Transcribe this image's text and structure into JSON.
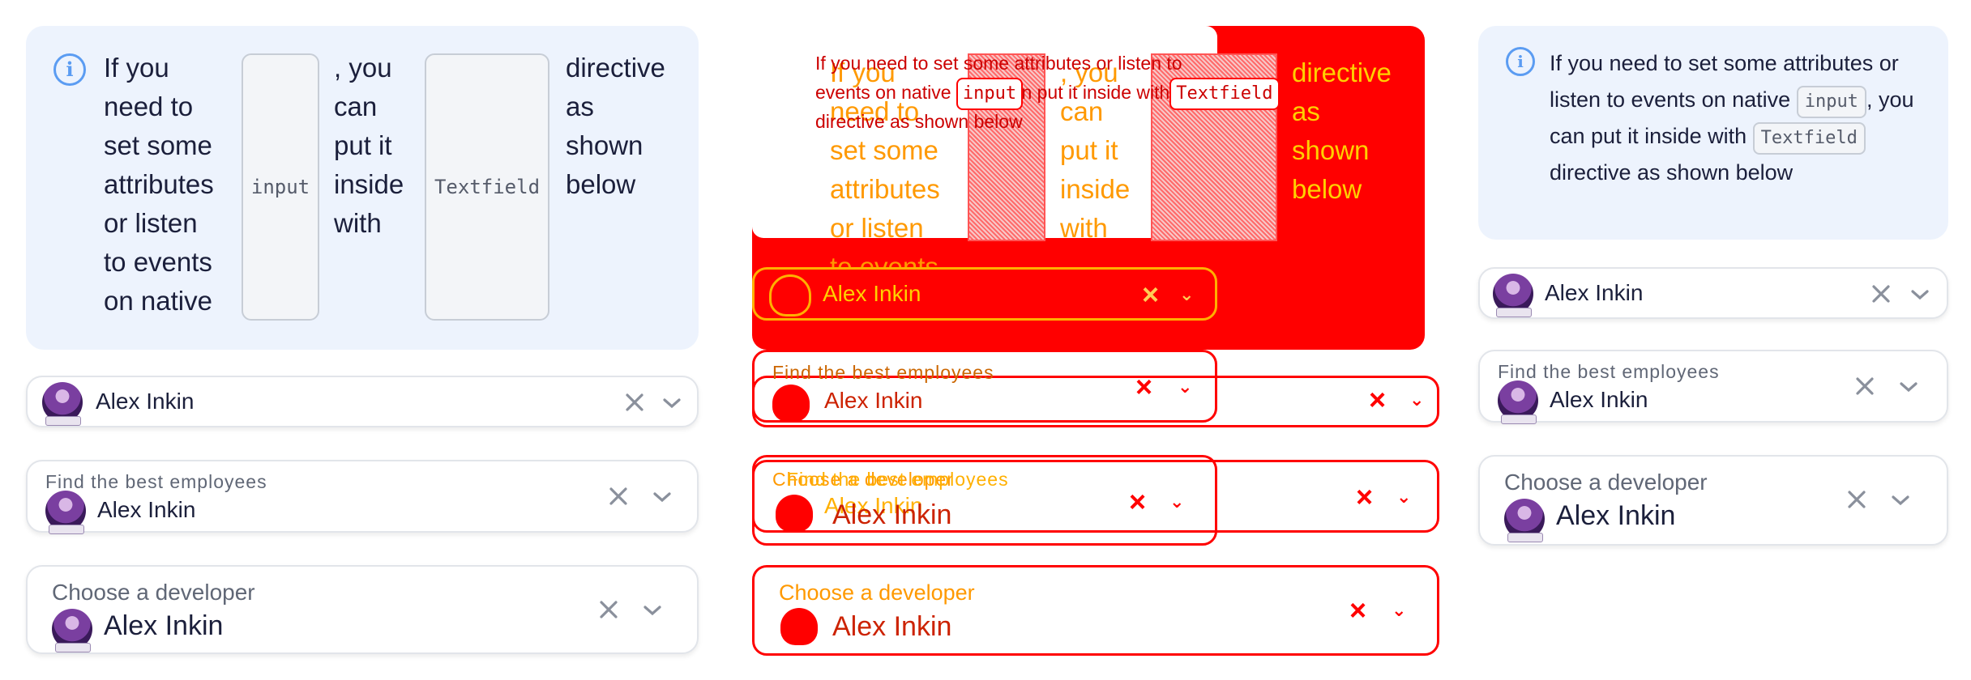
{
  "notice": {
    "icon": "info-icon",
    "text_1": "If you need to set some attributes or listen to events on native",
    "code_1": "input",
    "text_2": ", you can put it inside with",
    "code_2": "Textfield",
    "text_3": "directive as shown below",
    "accent": "#5b9cf2"
  },
  "notice_columns": {
    "col1": [
      "If you",
      "need to",
      "set some",
      "attributes",
      "or listen",
      "to events",
      "on native"
    ],
    "col2": [
      ", you",
      "can",
      "put it",
      "inside",
      "with"
    ],
    "col3": [
      "directive",
      "as",
      "shown",
      "below"
    ]
  },
  "select_simple": {
    "value": "Alex Inkin"
  },
  "select_labeled": {
    "label": "Find the best employees",
    "value": "Alex Inkin"
  },
  "select_large": {
    "label": "Choose a developer",
    "value": "Alex Inkin"
  },
  "middle": {
    "label_overlap": "Choose a developer",
    "label_overlap_2": "Find the best employees"
  },
  "colors": {
    "overlay_red": "#ff0000",
    "overlay_orange": "#ff9900",
    "text": "#1b1f3b"
  }
}
